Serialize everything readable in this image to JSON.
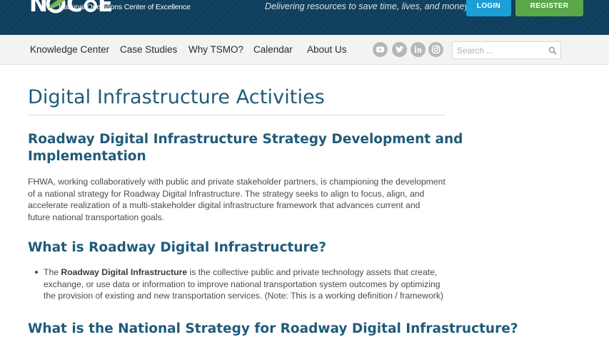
{
  "header": {
    "logo_text": "N CoE",
    "logo_subtitle": "National Operations Center of Excellence",
    "tagline": "Delivering resources to save time, lives, and money",
    "login_label": "LOGIN",
    "register_label": "REGISTER",
    "colors": {
      "background": "#0f3f5c",
      "login": "#1aa0d6",
      "register": "#5aa84a",
      "logo_leaf": "#7ab648"
    }
  },
  "nav": {
    "items": [
      {
        "label": "Knowledge Center"
      },
      {
        "label": "Case Studies"
      },
      {
        "label": "Why TSMO?"
      },
      {
        "label": "Calendar"
      },
      {
        "label": "About Us"
      }
    ],
    "social_icons": [
      "youtube-icon",
      "twitter-icon",
      "linkedin-icon",
      "instagram-icon"
    ],
    "search_placeholder": "Search ...",
    "search_value": ""
  },
  "content": {
    "page_title": "Digital Infrastructure Activities",
    "section1_heading_line1": "Roadway Digital Infrastructure Strategy Development and",
    "section1_heading_line2": "Implementation",
    "section1_p_line1": "FHWA, working collaboratively with public and private stakeholder partners, is championing the development",
    "section1_p_line2": "of a national strategy for Roadway Digital Infrastructure. The strategy seeks to align to focus, align, and",
    "section1_p_line3": "accelerate realization of a multi-stakeholder digital infrastructure framework that advances current and",
    "section1_p_line4": "future national transportation goals.",
    "section2_heading": "What is Roadway Digital Infrastructure?",
    "bullet_prefix": "The ",
    "bullet_bold": "Roadway Digital Infrastructure",
    "bullet_rest1": " is the collective public and private technology assets that create,",
    "bullet_line2": "exchange, or use data or information to improve national transportation system outcomes by optimizing",
    "bullet_line3": "the provision of existing and new transportation services.  (Note: This is a working definition / framework)",
    "section3_heading": "What is the National Strategy for Roadway Digital Infrastructure?",
    "colors": {
      "heading": "#1f5b7a",
      "body_text": "#4a4a4a"
    }
  }
}
